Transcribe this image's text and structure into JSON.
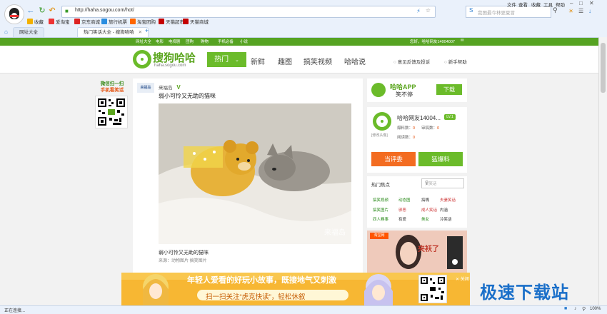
{
  "browser": {
    "menu": [
      "文件",
      "查看",
      "收藏",
      "工具",
      "帮助"
    ],
    "url": "http://haha.sogou.com/hot/",
    "search_placeholder": "我图最今林更夏冒",
    "bookmarks": [
      {
        "label": "收藏",
        "color": "#f3b000"
      },
      {
        "label": "爱淘宝",
        "color": "#e33"
      },
      {
        "label": "京东商城",
        "color": "#d22"
      },
      {
        "label": "旅行机票",
        "color": "#2a8de0"
      },
      {
        "label": "淘宝团购",
        "color": "#ff6600"
      },
      {
        "label": "天猫超市",
        "color": "#c40000"
      },
      {
        "label": "天猫商城",
        "color": "#c40000"
      }
    ],
    "tabs": [
      {
        "label": "网址大全"
      },
      {
        "label": "热门笑话大全 - 搜狗哈哈"
      }
    ],
    "status": "正在连接...",
    "zoom": "100%"
  },
  "site": {
    "topbar_links": [
      "网址大全",
      "电影",
      "电视剧",
      "团购",
      "购物",
      "手机必备",
      "小说"
    ],
    "topbar_user": "您好，哈哈网友14004007",
    "logo_text": "搜狗哈哈",
    "logo_sub": "haha.sogou.com",
    "nav": {
      "hot": "热门",
      "items": [
        "新鲜",
        "趣图",
        "搞笑视频",
        "哈哈说"
      ]
    },
    "header_links": {
      "feedback": "意见反馈及投诉",
      "help": "新手帮助"
    },
    "left_qr": {
      "line1": "微信扫一扫",
      "line2": "手机看笑话"
    },
    "post": {
      "poster_logo": "来福岛",
      "poster": "来福岛",
      "verified": "V",
      "title": "弱小可怜又无助的猫咪",
      "caption": "弱小可怜又无助的猫咪",
      "source": "来源：动物图片  搞笑图片",
      "image_watermark": "来福岛"
    },
    "app_banner": {
      "title": "哈哈APP",
      "slogan": "笑不停",
      "download": "下载"
    },
    "user": {
      "name": "哈哈网友14004...",
      "level": "LV.1",
      "avatar_hint": "[修改头像]",
      "stats": [
        {
          "label": "爆料数",
          "value": "0"
        },
        {
          "label": "审稿数",
          "value": "0"
        },
        {
          "label": "阅读数",
          "value": "0"
        }
      ],
      "btn_judge": "当评委",
      "btn_report": "猛爆料"
    },
    "hot": {
      "title": "热门焦点",
      "search_placeholder": "关笑话",
      "items": [
        {
          "label": "搞笑视频",
          "color": "#2a8a1a"
        },
        {
          "label": "动态图",
          "color": "#2a8a1a"
        },
        {
          "label": "搞嘴",
          "color": "#333"
        },
        {
          "label": "夫妻笑话",
          "color": "#c33"
        },
        {
          "label": "搞笑图片",
          "color": "#2a8a1a"
        },
        {
          "label": "邪恶",
          "color": "#c33"
        },
        {
          "label": "成人笑话",
          "color": "#c33"
        },
        {
          "label": "内涵",
          "color": "#333"
        },
        {
          "label": "四人糗事",
          "color": "#2a8a1a"
        },
        {
          "label": "有爱",
          "color": "#333"
        },
        {
          "label": "美女",
          "color": "#2a8a1a"
        },
        {
          "label": "冷笑话",
          "color": "#333"
        }
      ]
    },
    "ad": {
      "brand": "淘宝网",
      "text": "夹袄了"
    },
    "promo": {
      "line1": "年轻人爱看的好玩小故事，既接地气又刺激",
      "line2": "扫一扫关注“虎克快读”，轻松休叙",
      "close": "关闭"
    }
  },
  "watermark": "极速下载站"
}
